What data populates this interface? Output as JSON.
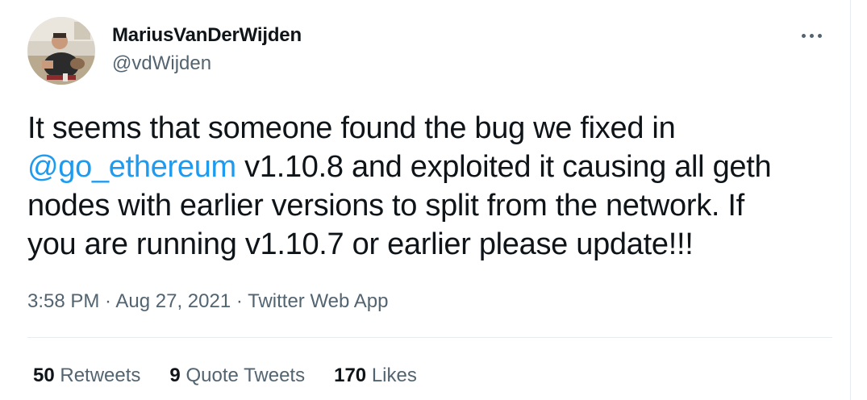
{
  "author": {
    "display_name": "MariusVanDerWijden",
    "handle": "@vdWijden"
  },
  "icons": {
    "avatar": "profile-photo",
    "more": "more-horizontal-icon"
  },
  "tweet": {
    "line1": "It seems that someone found the bug we fixed in",
    "mention": "@go_ethereum",
    "line2_rest": " v1.10.8 and exploited it causing all geth",
    "line3": "nodes with earlier versions to split from the network. If",
    "line4": "you are running v1.10.7 or earlier please update!!!"
  },
  "meta": {
    "time": "3:58 PM",
    "sep1": " · ",
    "date": "Aug 27, 2021",
    "sep2": " · ",
    "source": "Twitter Web App"
  },
  "stats": {
    "retweets_count": "50",
    "retweets_label": "Retweets",
    "quotes_count": "9",
    "quotes_label": "Quote Tweets",
    "likes_count": "170",
    "likes_label": "Likes"
  },
  "colors": {
    "link": "#1d9bf0",
    "text": "#0f1419",
    "secondary": "#536471",
    "border": "#e6ecf0"
  }
}
